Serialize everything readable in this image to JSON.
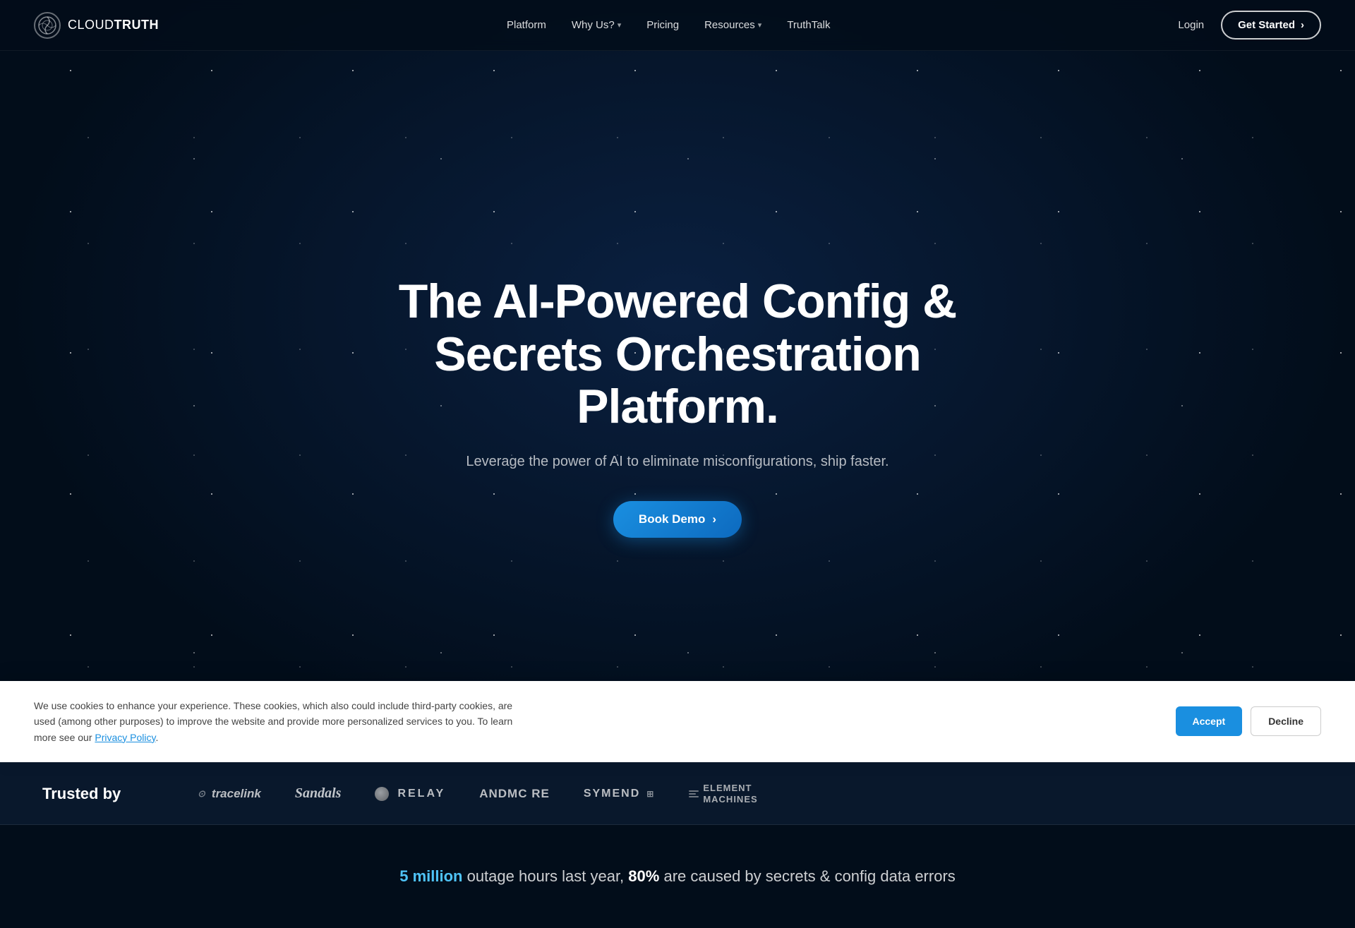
{
  "brand": {
    "name_part1": "CLOUD",
    "name_part2": "TRUTH"
  },
  "nav": {
    "links": [
      {
        "label": "Platform",
        "has_dropdown": false
      },
      {
        "label": "Why Us?",
        "has_dropdown": true
      },
      {
        "label": "Pricing",
        "has_dropdown": false
      },
      {
        "label": "Resources",
        "has_dropdown": true
      },
      {
        "label": "TruthTalk",
        "has_dropdown": false
      }
    ],
    "login_label": "Login",
    "get_started_label": "Get Started"
  },
  "hero": {
    "title": "The AI-Powered Config & Secrets Orchestration Platform.",
    "subtitle": "Leverage the power of AI to eliminate misconfigurations, ship faster.",
    "cta_label": "Book Demo"
  },
  "trusted": {
    "label": "Trusted by",
    "logos": [
      {
        "name": "tracelink",
        "text": "tracelink"
      },
      {
        "name": "sandals",
        "text": "Sandals"
      },
      {
        "name": "relay",
        "text": "RELAY"
      },
      {
        "name": "andmore",
        "text": "ANDMC RE"
      },
      {
        "name": "symend",
        "text": "SYMEND"
      },
      {
        "name": "element",
        "text": "ELEM\nMACHI"
      }
    ]
  },
  "stats": {
    "highlight1": "5 million",
    "text_middle": " outage hours last year, ",
    "highlight2": "80%",
    "text_end": " are caused by secrets & config data errors"
  },
  "cookie": {
    "text": "We use cookies to enhance your experience. These cookies, which also could include third-party cookies, are used (among other purposes) to improve the website and provide more personalized services to you. To learn more see our ",
    "link_text": "Privacy Policy",
    "accept_label": "Accept",
    "decline_label": "Decline"
  }
}
